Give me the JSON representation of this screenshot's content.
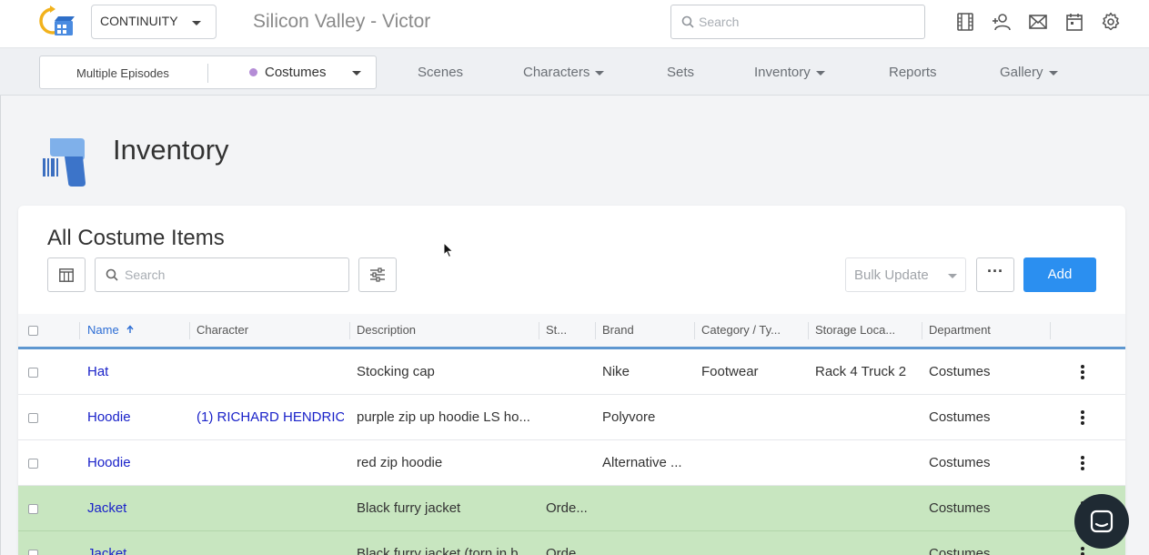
{
  "topbar": {
    "app_selector": "CONTINUITY",
    "project_title": "Silicon Valley - Victor",
    "search_placeholder": "Search",
    "icons": [
      "film-icon",
      "add-user-icon",
      "mail-icon",
      "calendar-icon",
      "gear-icon"
    ]
  },
  "nav": {
    "episodes": "Multiple Episodes",
    "department": "Costumes",
    "department_color": "#b48cd6",
    "links": {
      "scenes": "Scenes",
      "characters": "Characters",
      "sets": "Sets",
      "inventory": "Inventory",
      "reports": "Reports",
      "gallery": "Gallery"
    }
  },
  "page": {
    "title": "Inventory"
  },
  "list": {
    "title": "All Costume Items",
    "search_placeholder": "Search",
    "bulk_update": "Bulk Update",
    "more": "···",
    "add": "Add",
    "columns": {
      "name": "Name",
      "character": "Character",
      "description": "Description",
      "status": "St...",
      "brand": "Brand",
      "category": "Category / Ty...",
      "storage": "Storage Loca...",
      "department": "Department"
    },
    "rows": [
      {
        "name": "Hat",
        "character": "",
        "description": "Stocking cap",
        "status": "",
        "brand": "Nike",
        "category": "Footwear",
        "storage": "Rack 4 Truck 2",
        "department": "Costumes",
        "highlight": false
      },
      {
        "name": "Hoodie",
        "character": "(1) RICHARD HENDRIC...",
        "description": "purple zip up hoodie LS ho...",
        "status": "",
        "brand": "Polyvore",
        "category": "",
        "storage": "",
        "department": "Costumes",
        "highlight": false
      },
      {
        "name": "Hoodie",
        "character": "",
        "description": "red zip hoodie",
        "status": "",
        "brand": "Alternative ...",
        "category": "",
        "storage": "",
        "department": "Costumes",
        "highlight": false
      },
      {
        "name": "Jacket",
        "character": "",
        "description": "Black furry jacket",
        "status": "Orde...",
        "brand": "",
        "category": "",
        "storage": "",
        "department": "Costumes",
        "highlight": true
      },
      {
        "name": "Jacket",
        "character": "",
        "description": "Black furry jacket (torn in b...",
        "status": "Orde...",
        "brand": "",
        "category": "",
        "storage": "",
        "department": "Costumes",
        "highlight": true
      }
    ]
  },
  "colors": {
    "accent": "#2b8ff0",
    "link": "#1a22c9",
    "highlight_row": "#c8e6c0",
    "header_rule": "#5e97d0"
  }
}
